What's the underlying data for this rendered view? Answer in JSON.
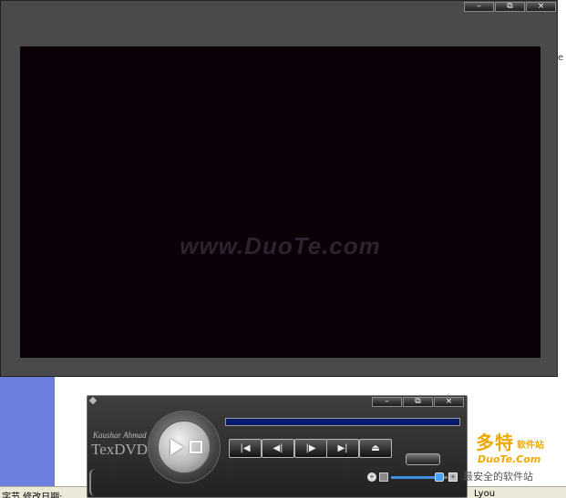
{
  "video_window": {
    "watermark": "www.DuoTe.com",
    "controls": {
      "minimize": "–",
      "restore": "⧉",
      "close": "×"
    }
  },
  "player": {
    "brand_small": "Kaushar Ahmad",
    "brand_tex": "Tex",
    "brand_dvd": "DVD",
    "controls": {
      "minimize": "–",
      "restore": "⧉",
      "close": "×"
    },
    "transport": {
      "prev": "|◀",
      "rewind": "◀|",
      "forward": "|▶",
      "next": "▶|",
      "eject": "⏏"
    },
    "volume_level": 0.85,
    "volume_icon": "+",
    "volume_plus": "+",
    "progress_level": 1.0,
    "progress_color": "#0a1a6e"
  },
  "logo": {
    "title": "多特",
    "sub": "软件站",
    "url": "DuoTe.Com",
    "slogan": "最安全的软件站"
  },
  "background": {
    "strip_left": "字节  修改日期:",
    "strip_right": "Lyou",
    "right_glyph": "e"
  },
  "colors": {
    "video_bg": "#0c0008",
    "panel_bg": "#2e2e2e",
    "accent": "#3c8fe0"
  }
}
